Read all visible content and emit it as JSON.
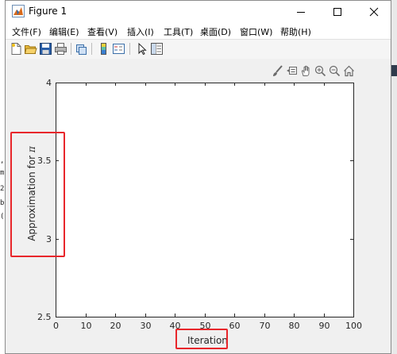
{
  "window": {
    "title": "Figure 1",
    "icon": "matlab-figure-icon"
  },
  "menu": [
    "文件(F)",
    "编辑(E)",
    "查看(V)",
    "插入(I)",
    "工具(T)",
    "桌面(D)",
    "窗口(W)",
    "帮助(H)"
  ],
  "toolbar": [
    "new-figure-icon",
    "open-file-icon",
    "save-icon",
    "print-icon",
    "link-plot-icon",
    "colorbar-icon",
    "legend-icon",
    "pointer-icon",
    "property-inspector-icon"
  ],
  "axes_toolbar": [
    "brush-icon",
    "datatip-icon",
    "pan-icon",
    "zoom-in-icon",
    "zoom-out-icon",
    "home-icon"
  ],
  "chart_data": {
    "type": "line",
    "series": [],
    "xlabel": "Iteration",
    "ylabel": "Approximation for π",
    "ylabel_text": "Approximation for",
    "ylabel_symbol": "π",
    "xlim": [
      0,
      100
    ],
    "ylim": [
      2.5,
      4
    ],
    "x_ticks": [
      "0",
      "10",
      "20",
      "30",
      "40",
      "50",
      "60",
      "70",
      "80",
      "90",
      "100"
    ],
    "y_ticks": [
      "2.5",
      "3",
      "3.5",
      "4"
    ],
    "grid": false
  },
  "background_fragments": [
    ",",
    "m",
    "2",
    "b",
    "("
  ],
  "highlight_color": "#e8262b"
}
